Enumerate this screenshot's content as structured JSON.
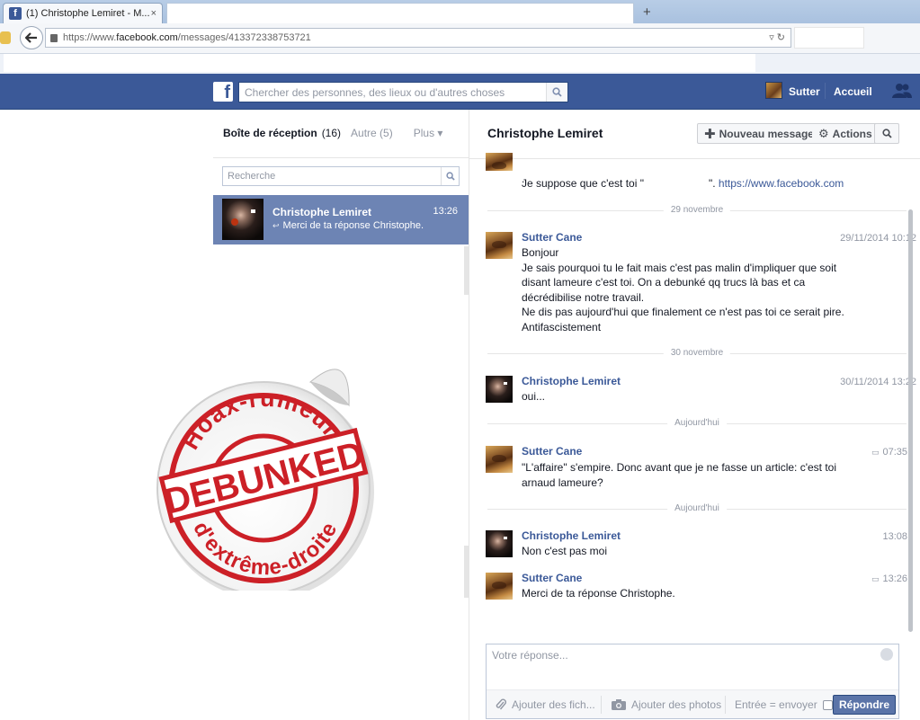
{
  "browser": {
    "tab_title": "(1) Christophe Lemiret - M...",
    "tab_favicon": "f",
    "tab_close": "×",
    "new_tab": "+",
    "url_prefix": "https://www.",
    "url_domain": "facebook.com",
    "url_path": "/messages/413372338753721"
  },
  "fb_header": {
    "logo": "f",
    "search_placeholder": "Chercher des personnes, des lieux ou d'autres choses",
    "user_name": "Sutter",
    "home_label": "Accueil",
    "brand_color": "#3b5998"
  },
  "inbox": {
    "title": "Boîte de réception",
    "count": "(16)",
    "other": "Autre (5)",
    "more": "Plus",
    "search_placeholder": "Recherche",
    "threads": [
      {
        "name": "Christophe Lemiret",
        "time": "13:26",
        "snippet": "Merci de ta réponse Christophe."
      }
    ],
    "selected_color": "#6d84b4"
  },
  "stamp": {
    "top_text": "Hoax-rumeurs",
    "center_text": "DEBUNKED",
    "bottom_text": "d'extrême-droite",
    "color": "#cc2027"
  },
  "conversation": {
    "title": "Christophe Lemiret",
    "new_message": "Nouveau message",
    "actions": "Actions",
    "partial_message": {
      "text_before": "Je suppose que c'est toi \"",
      "text_after": "\". ",
      "link": "https://www.facebook.com",
      "tail": "."
    },
    "messages": [
      {
        "separator": "29 novembre",
        "sender": "Sutter Cane",
        "time": "29/11/2014 10:12",
        "text": "Bonjour\nJe sais pourquoi tu le fait mais c'est pas malin d'impliquer que soit\ndisant lameure c'est toi. On a debunké qq trucs là bas et ca\ndécrédibilise notre travail.\nNe dis pas aujourd'hui que finalement ce n'est pas toi ce serait pire.\nAntifascistement"
      },
      {
        "separator": "30 novembre",
        "sender": "Christophe Lemiret",
        "time": "30/11/2014 13:22",
        "text": "oui..."
      },
      {
        "separator": "Aujourd'hui",
        "sender": "Sutter Cane",
        "time": "07:35",
        "text": "\"L'affaire\" s'empire. Donc avant que je ne fasse un article: c'est toi\narnaud lameure?"
      },
      {
        "separator": "Aujourd'hui",
        "sender": "Christophe Lemiret",
        "time": "13:08",
        "text": "Non c'est pas moi"
      },
      {
        "sender": "Sutter Cane",
        "time": "13:26",
        "text": "Merci de ta réponse Christophe."
      }
    ]
  },
  "composer": {
    "placeholder": "Votre réponse...",
    "attach_file": "Ajouter des fich...",
    "add_photos": "Ajouter des photos",
    "enter_send": "Entrée = envoyer",
    "reply_button": "Répondre"
  }
}
